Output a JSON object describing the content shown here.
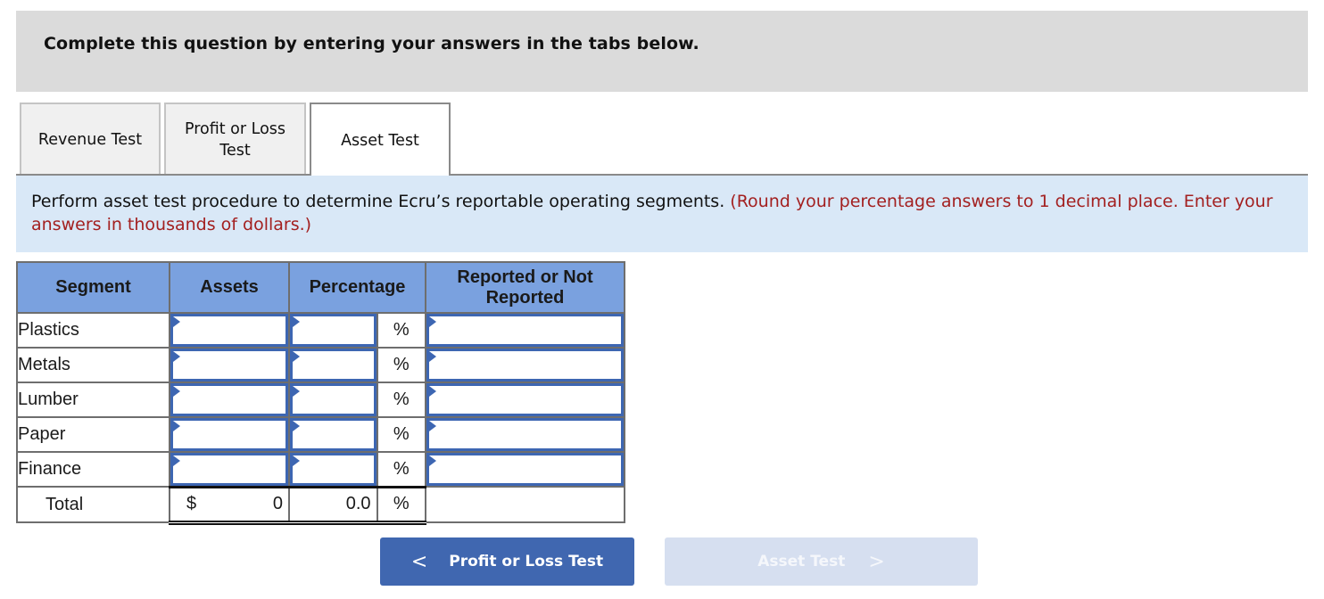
{
  "header": {
    "title": "Complete this question by entering your answers in the tabs below."
  },
  "tabs": [
    {
      "label": "Revenue Test",
      "active": false
    },
    {
      "label": "Profit or Loss Test",
      "active": false
    },
    {
      "label": "Asset Test",
      "active": true
    }
  ],
  "instructions": {
    "text": "Perform asset test procedure to determine Ecru’s reportable operating segments.",
    "note": "(Round your percentage answers to 1 decimal place. Enter your answers in thousands of dollars.)"
  },
  "table": {
    "headers": {
      "segment": "Segment",
      "assets": "Assets",
      "percentage": "Percentage",
      "reported": "Reported or Not Reported"
    },
    "percent_sign": "%",
    "rows": [
      {
        "segment": "Plastics",
        "assets": "",
        "percentage": "",
        "reported": ""
      },
      {
        "segment": "Metals",
        "assets": "",
        "percentage": "",
        "reported": ""
      },
      {
        "segment": "Lumber",
        "assets": "",
        "percentage": "",
        "reported": ""
      },
      {
        "segment": "Paper",
        "assets": "",
        "percentage": "",
        "reported": ""
      },
      {
        "segment": "Finance",
        "assets": "",
        "percentage": "",
        "reported": ""
      }
    ],
    "total": {
      "label": "Total",
      "currency": "$",
      "assets": "0",
      "percentage": "0.0",
      "percent_sign": "%"
    }
  },
  "nav": {
    "prev_label": "Profit or Loss Test",
    "prev_icon": "chevron-left-icon",
    "prev_glyph": "<",
    "next_label": "Asset Test",
    "next_icon": "chevron-right-icon",
    "next_glyph": ">",
    "next_disabled": true
  },
  "colors": {
    "header_bg": "#dbdbdb",
    "instructions_bg": "#d9e8f7",
    "note_red": "#a32020",
    "table_header_bg": "#7aa1df",
    "input_border": "#3d66b2",
    "prev_button_bg": "#4067b0",
    "next_button_bg_disabled": "#d6dff0"
  }
}
